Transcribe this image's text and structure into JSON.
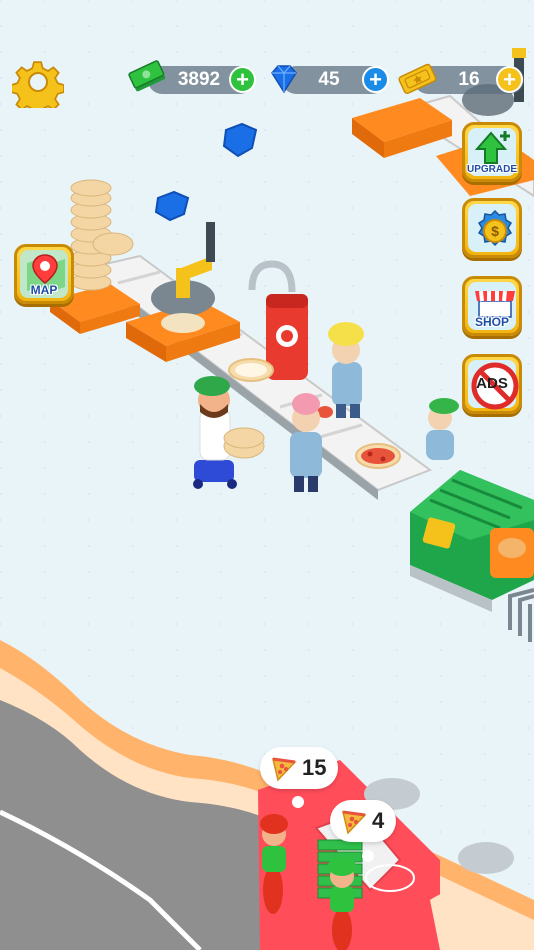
{
  "hud": {
    "cash": {
      "value": "3892",
      "icon": "cash-stack-icon"
    },
    "gems": {
      "value": "45",
      "icon": "blue-gem-icon"
    },
    "tickets": {
      "value": "16",
      "icon": "golden-ticket-icon"
    },
    "plus_symbol": "+"
  },
  "side_buttons": {
    "map": {
      "label": "MAP",
      "icon": "map-pin-icon"
    },
    "upgrade": {
      "label": "UPGRADE",
      "icon": "upgrade-arrow-icon"
    },
    "money": {
      "icon": "coin-badge-icon"
    },
    "shop": {
      "label": "SHOP",
      "icon": "shop-awning-icon"
    },
    "no_ads": {
      "label": "ADS",
      "icon": "no-ads-icon"
    }
  },
  "orders": [
    {
      "count": "15",
      "icon": "pizza-slice-icon"
    },
    {
      "count": "4",
      "icon": "pizza-slice-icon"
    }
  ],
  "colors": {
    "floor": "#e9f4f8",
    "conveyor": "#f4f4f4",
    "machine_orange": "#ff8a1f",
    "oven_green": "#1fa64a",
    "road": "#8e8e8e",
    "accent_yellow": "#f5c21b"
  }
}
